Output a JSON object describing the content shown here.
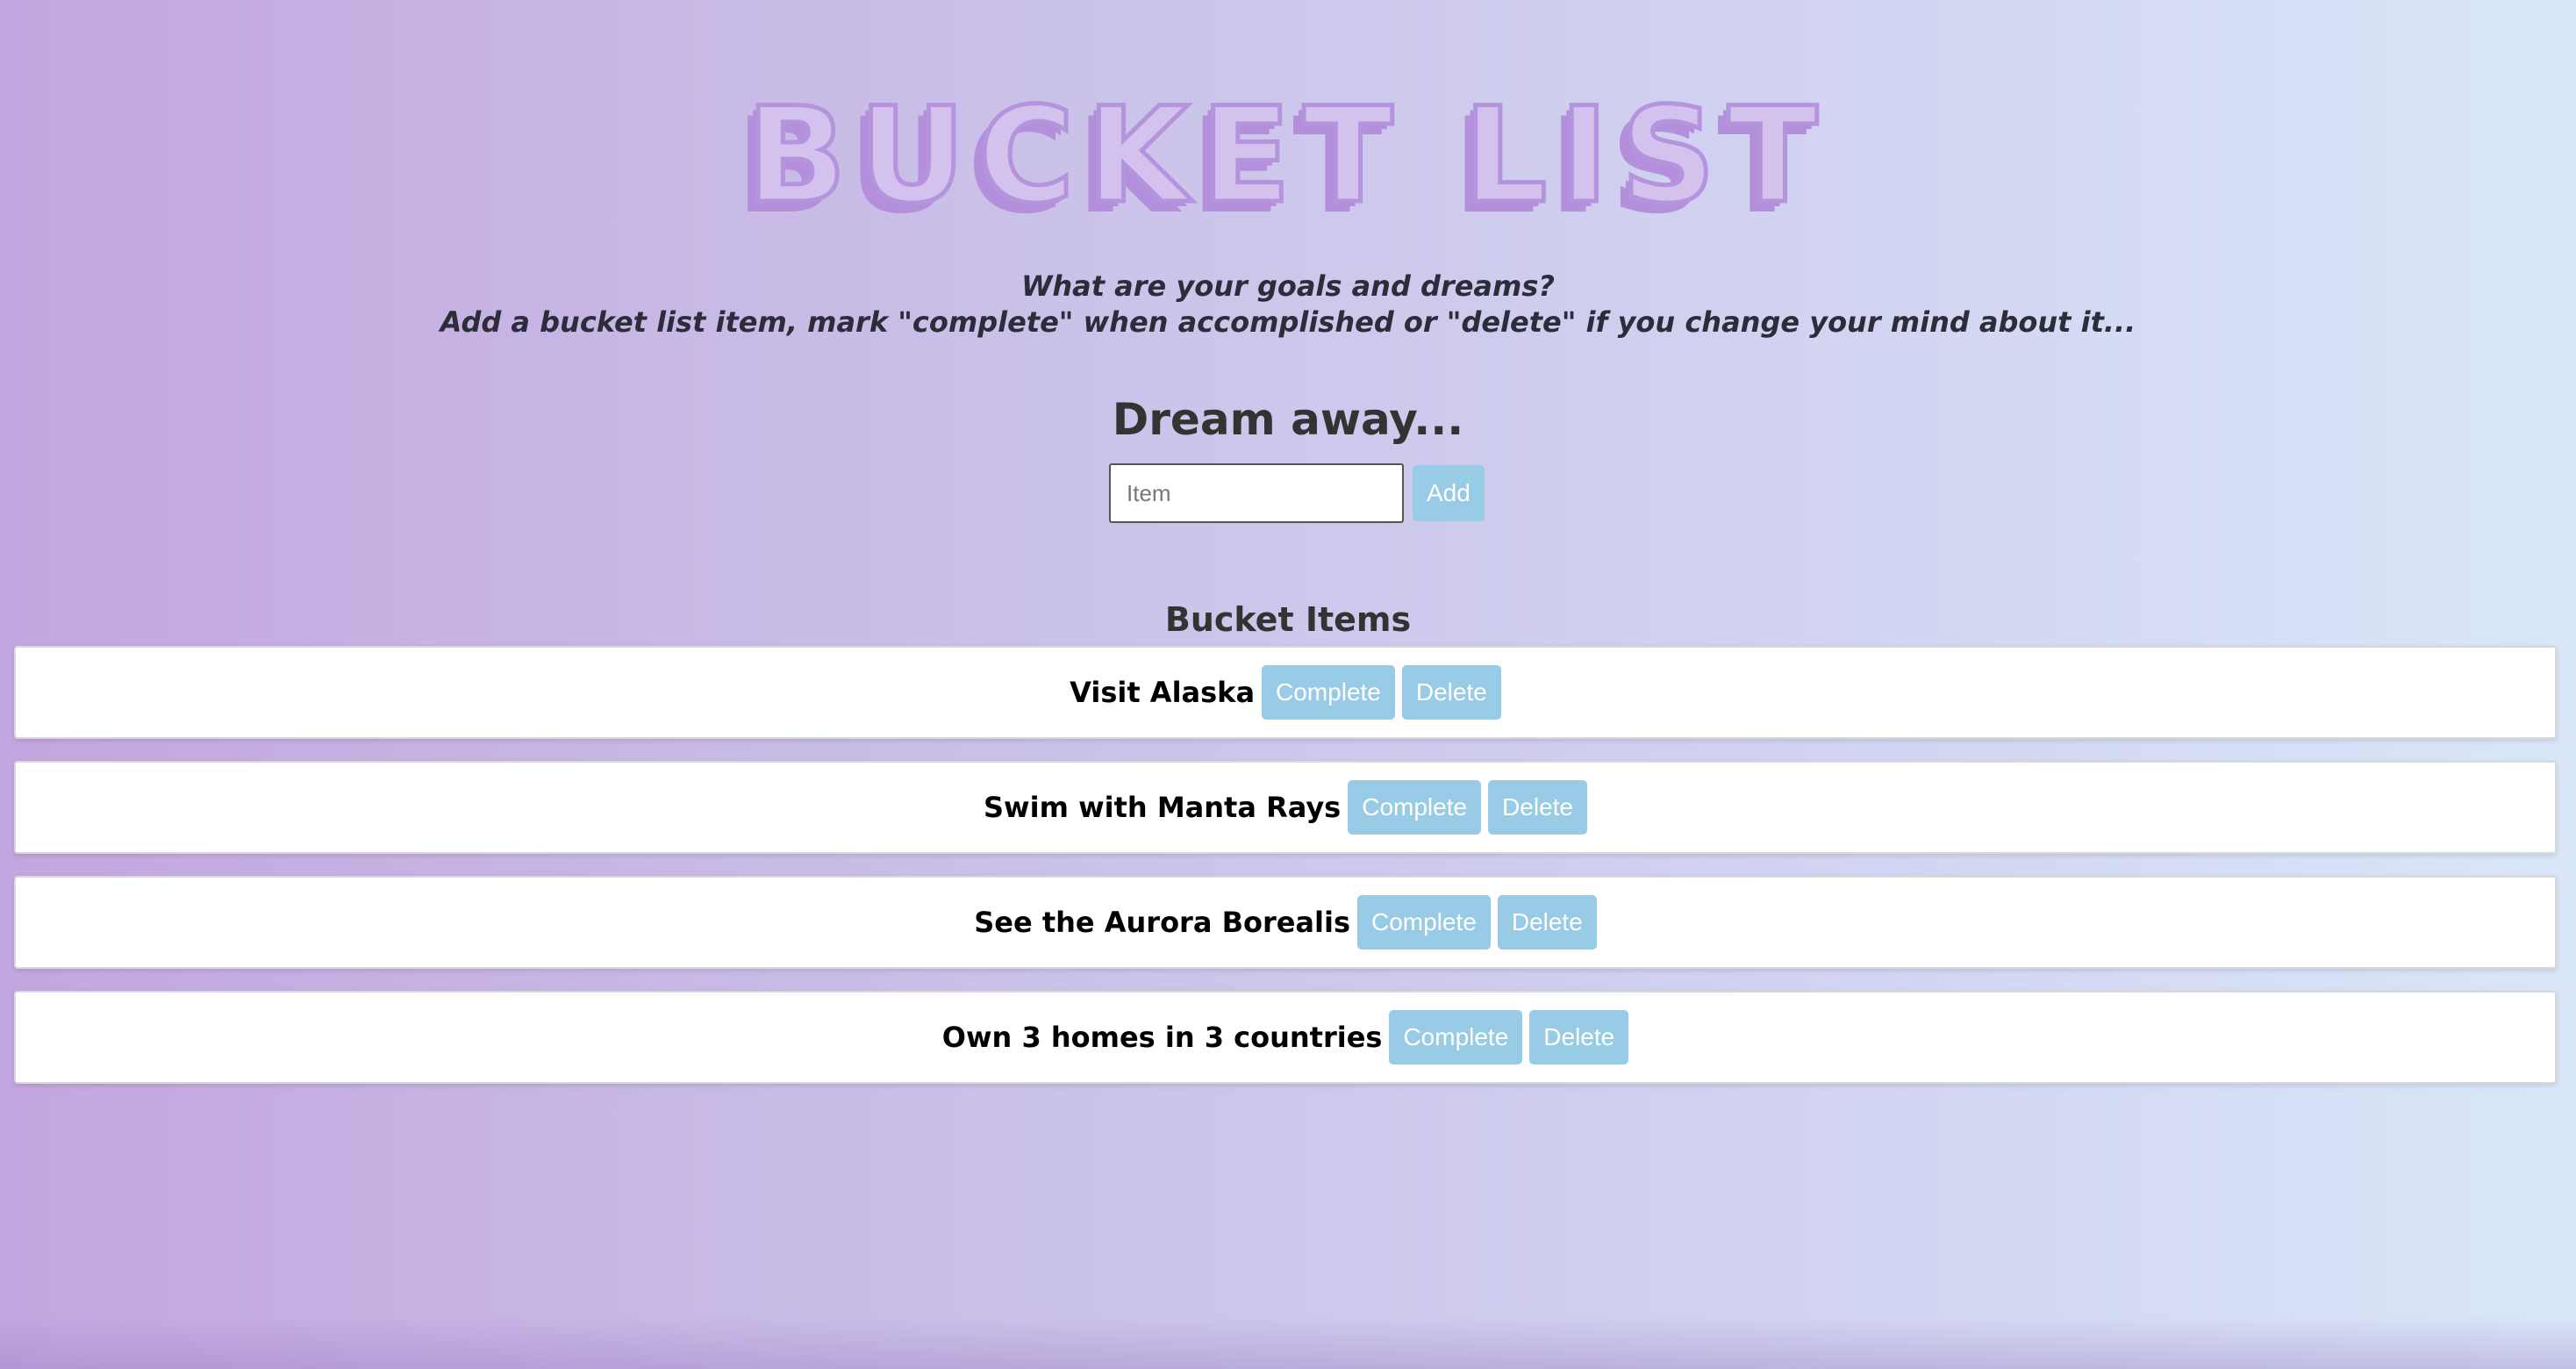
{
  "header": {
    "title": "BUCKET LIST",
    "intro_line1": "What are your goals and dreams?",
    "intro_line2": "Add a bucket list item, mark \"complete\" when accomplished or \"delete\" if you change your mind about it..."
  },
  "form": {
    "heading": "Dream away...",
    "input_placeholder": "Item",
    "input_value": "",
    "add_label": "Add"
  },
  "list": {
    "heading": "Bucket Items",
    "items": [
      {
        "text": "Visit Alaska",
        "complete_label": "Complete",
        "delete_label": "Delete"
      },
      {
        "text": "Swim with Manta Rays",
        "complete_label": "Complete",
        "delete_label": "Delete"
      },
      {
        "text": "See the Aurora Borealis",
        "complete_label": "Complete",
        "delete_label": "Delete"
      },
      {
        "text": "Own 3 homes in 3 countries",
        "complete_label": "Complete",
        "delete_label": "Delete"
      }
    ]
  },
  "colors": {
    "button": "#98cbe6",
    "title_fill": "#d3c2ee",
    "title_outline": "#b494dc",
    "background_left": "#c3a6df",
    "background_right": "#d9e6f8"
  }
}
